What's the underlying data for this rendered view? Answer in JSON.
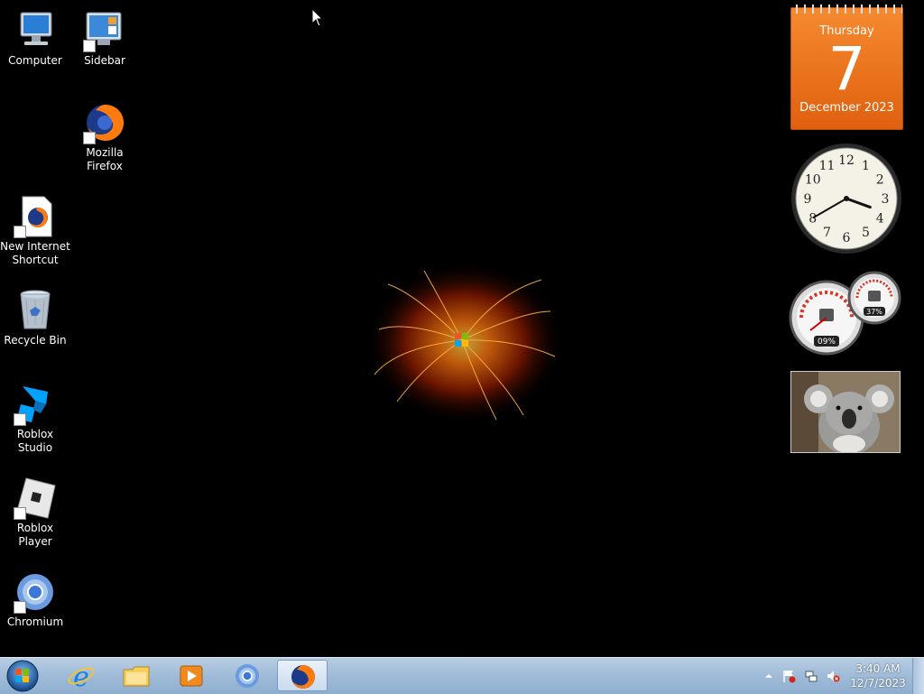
{
  "desktop": {
    "icons": [
      {
        "label": "Computer",
        "icon": "computer-icon"
      },
      {
        "label": "Sidebar",
        "icon": "sidebar-icon"
      },
      {
        "label": "Mozilla Firefox",
        "icon": "firefox-icon"
      },
      {
        "label": "New Internet Shortcut",
        "icon": "internet-shortcut-icon"
      },
      {
        "label": "Recycle Bin",
        "icon": "recycle-bin-icon"
      },
      {
        "label": "Roblox Studio",
        "icon": "roblox-studio-icon"
      },
      {
        "label": "Roblox Player",
        "icon": "roblox-player-icon"
      },
      {
        "label": "Chromium",
        "icon": "chromium-icon"
      }
    ]
  },
  "gadgets": {
    "calendar": {
      "weekday": "Thursday",
      "day": "7",
      "month_year": "December 2023"
    },
    "clock": {
      "numerals": [
        "12",
        "1",
        "2",
        "3",
        "4",
        "5",
        "6",
        "7",
        "8",
        "9",
        "10",
        "11"
      ],
      "hour": 3,
      "minute": 40
    },
    "cpu_meter": {
      "cpu": "09%",
      "memory": "37%"
    },
    "slideshow": {
      "subject": "koala-photo"
    }
  },
  "taskbar": {
    "start": "windows-start-orb",
    "pinned": [
      "internet-explorer-icon",
      "file-explorer-icon",
      "media-player-icon",
      "chromium-icon",
      "firefox-icon"
    ],
    "active": "firefox-icon",
    "tray": {
      "time": "3:40 AM",
      "date": "12/7/2023",
      "icons": [
        "show-hidden-icons-arrow",
        "action-center-flag-icon",
        "network-icon",
        "volume-muted-icon"
      ]
    }
  },
  "colors": {
    "taskbar": "#9fbbd8",
    "calendar": "#e8701a"
  }
}
